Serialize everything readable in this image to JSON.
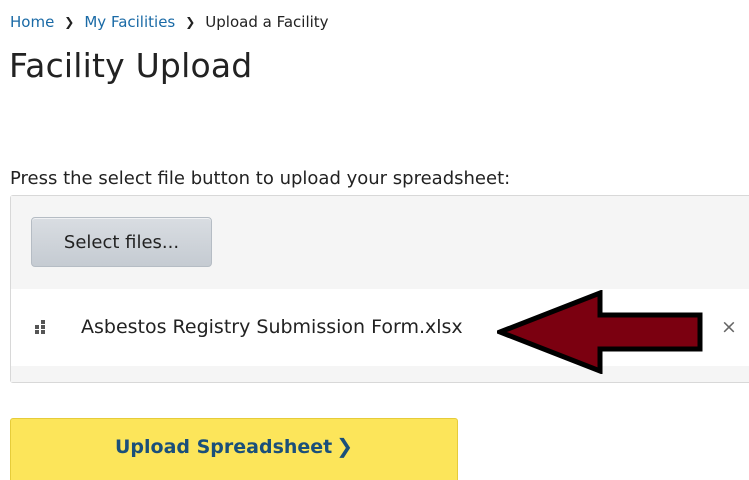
{
  "breadcrumb": {
    "items": [
      "Home",
      "My Facilities"
    ],
    "current": "Upload a Facility"
  },
  "page": {
    "title": "Facility Upload",
    "instruction": "Press the select file button to upload your spreadsheet:"
  },
  "upload": {
    "select_label": "Select files...",
    "files": [
      {
        "name": "Asbestos Registry Submission Form.xlsx"
      }
    ],
    "remove_label": "×"
  },
  "submit": {
    "label": "Upload Spreadsheet"
  },
  "colors": {
    "link": "#1a6aa6",
    "submit_bg": "#fce55a",
    "submit_text": "#1a4f7a",
    "arrow_fill": "#7b0010"
  },
  "icons": {
    "breadcrumb_separator": "chevron-right-icon",
    "file": "file-grip-icon",
    "remove": "close-icon",
    "submit": "chevron-right-icon"
  }
}
